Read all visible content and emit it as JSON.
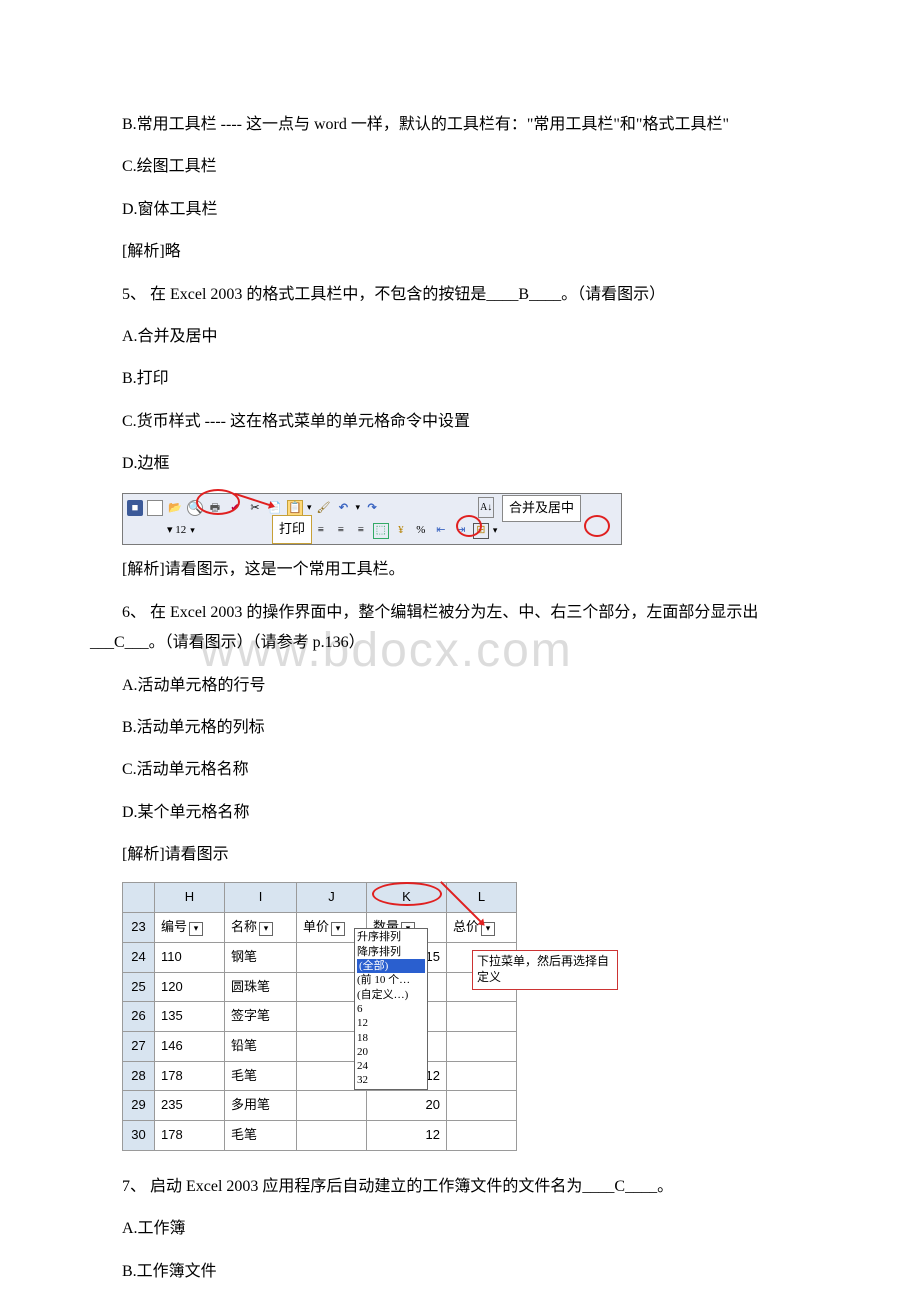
{
  "watermark": "www.bdocx.com",
  "q4": {
    "optB": "B.常用工具栏 ---- 这一点与 word 一样，默认的工具栏有：\"常用工具栏\"和\"格式工具栏\"",
    "optC": "C.绘图工具栏",
    "optD": "D.窗体工具栏",
    "explain": " [解析]略"
  },
  "q5": {
    "stem": "5、 在 Excel 2003 的格式工具栏中，不包含的按钮是____B____。（请看图示）",
    "optA": "A.合并及居中",
    "optB": "B.打印",
    "optC": "C.货币样式 ---- 这在格式菜单的单元格命令中设置",
    "optD": "D.边框",
    "img_print_label": "打印",
    "img_merge_label": "合并及居中",
    "img_font_size": "12",
    "img_percent": "%",
    "explain": " [解析]请看图示，这是一个常用工具栏。"
  },
  "q6": {
    "stem_a": "6、 在 Excel 2003 的操作界面中，整个编辑栏被分为左、中、右三个部分，左面部分显示出___C___。（请看图示）（请参考 p.136）",
    "optA": "A.活动单元格的行号",
    "optB": "B.活动单元格的列标",
    "optC": "C.活动单元格名称",
    "optD": "D.某个单元格名称",
    "explain": " [解析]请看图示",
    "table": {
      "cols": [
        "H",
        "I",
        "J",
        "K",
        "L"
      ],
      "header_row_num": "23",
      "headers": [
        "编号",
        "名称",
        "单价",
        "数量",
        "总价"
      ],
      "rows": [
        {
          "n": "24",
          "h": "110",
          "i": "钢笔",
          "j": "",
          "k": "15",
          "l": ""
        },
        {
          "n": "25",
          "h": "120",
          "i": "圆珠笔",
          "j": "",
          "k": "",
          "l": ""
        },
        {
          "n": "26",
          "h": "135",
          "i": "签字笔",
          "j": "",
          "k": "",
          "l": ""
        },
        {
          "n": "27",
          "h": "146",
          "i": "铅笔",
          "j": "",
          "k": "",
          "l": ""
        },
        {
          "n": "28",
          "h": "178",
          "i": "毛笔",
          "j": "",
          "k": "12",
          "l": ""
        },
        {
          "n": "29",
          "h": "235",
          "i": "多用笔",
          "j": "",
          "k": "20",
          "l": ""
        },
        {
          "n": "30",
          "h": "178",
          "i": "毛笔",
          "j": "",
          "k": "12",
          "l": ""
        }
      ],
      "dropdown_items": [
        "升序排列",
        "降序排列",
        "(全部)",
        "(前 10 个…",
        "(自定义…)",
        "6",
        "12",
        "18",
        "20",
        "24",
        "32"
      ],
      "callout": "下拉菜单，然后再选择自定义"
    }
  },
  "q7": {
    "stem": "7、 启动 Excel 2003 应用程序后自动建立的工作簿文件的文件名为____C____。",
    "optA": "A.工作簿",
    "optB": "B.工作簿文件"
  }
}
